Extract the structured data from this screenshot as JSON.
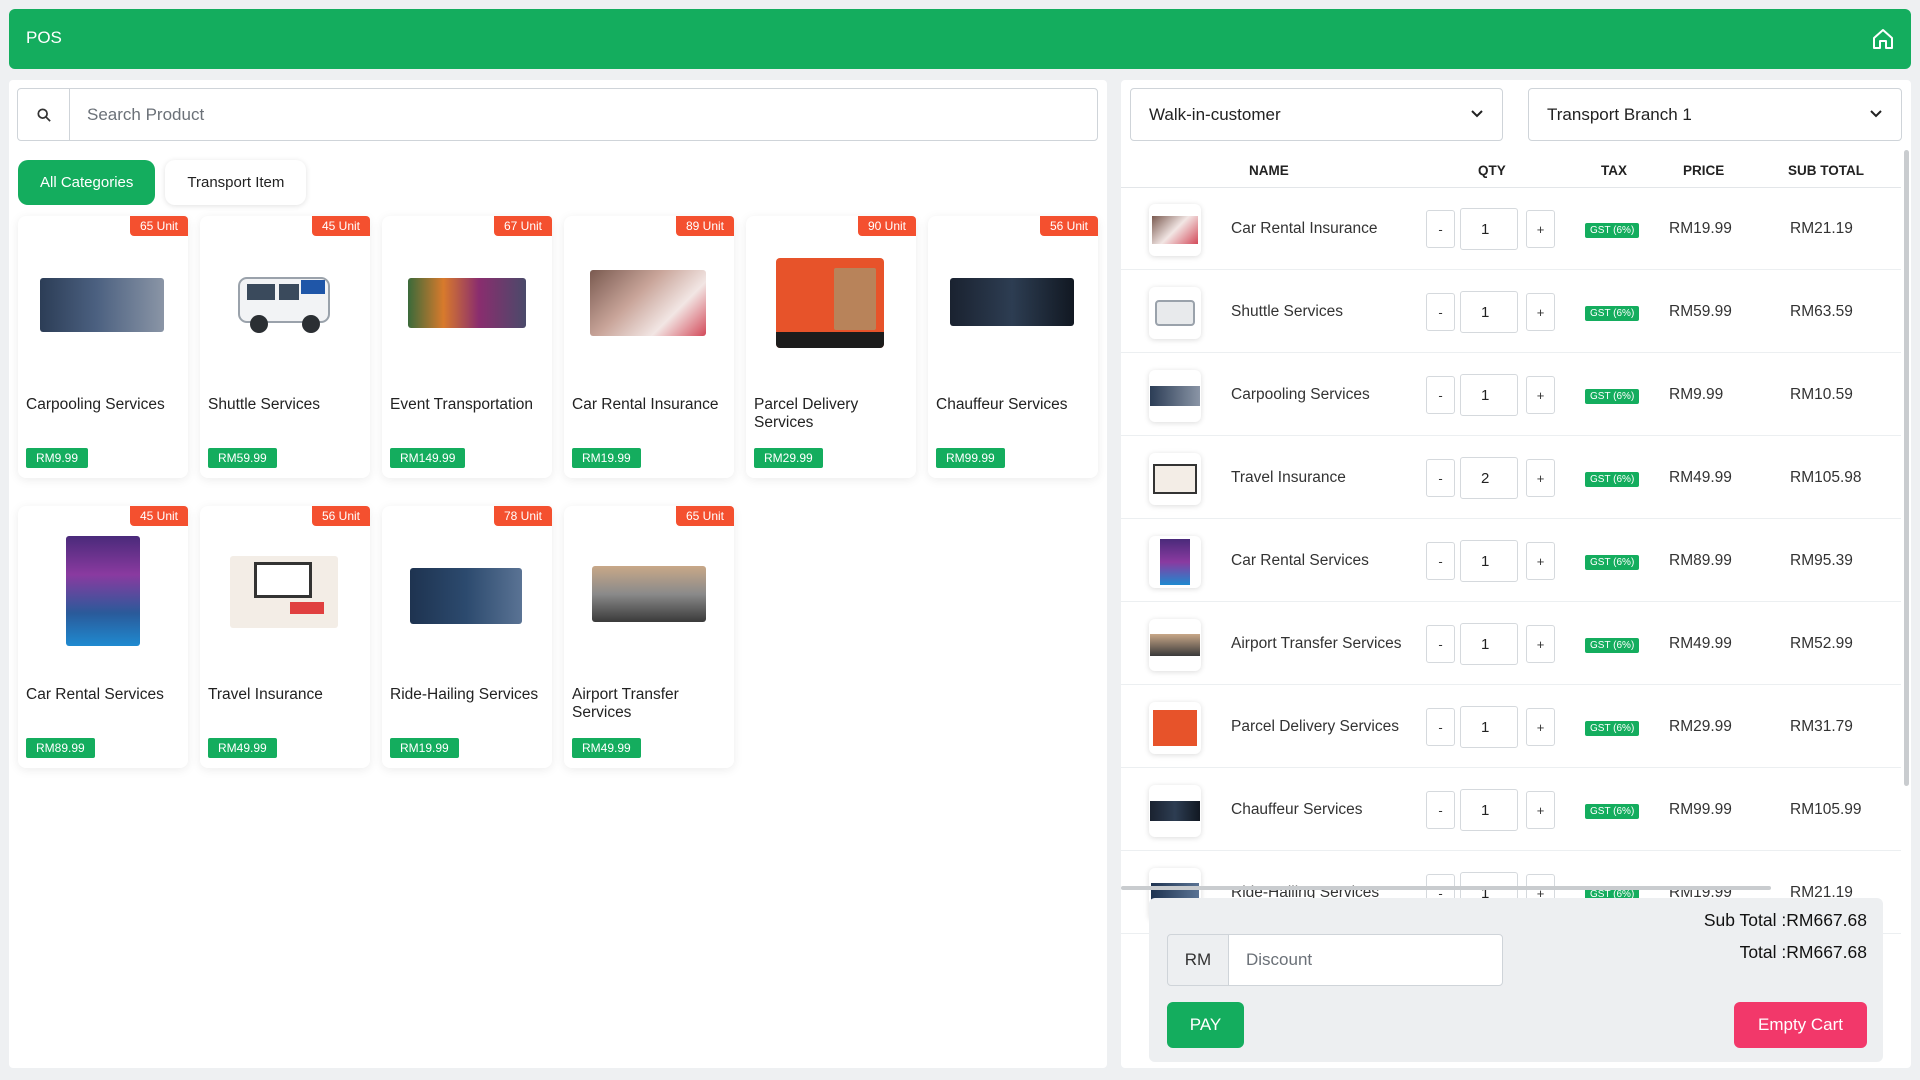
{
  "header": {
    "title": "POS",
    "home_icon": "home-icon"
  },
  "search": {
    "placeholder": "Search Product",
    "value": ""
  },
  "categories": [
    "All Categories",
    "Transport Item"
  ],
  "products": [
    {
      "name": "Carpooling Services",
      "price": "RM9.99",
      "stock": "65 Unit"
    },
    {
      "name": "Shuttle Services",
      "price": "RM59.99",
      "stock": "45 Unit"
    },
    {
      "name": "Event Transportation",
      "price": "RM149.99",
      "stock": "67 Unit"
    },
    {
      "name": "Car Rental Insurance",
      "price": "RM19.99",
      "stock": "89 Unit"
    },
    {
      "name": "Parcel Delivery Services",
      "price": "RM29.99",
      "stock": "90 Unit"
    },
    {
      "name": "Chauffeur Services",
      "price": "RM99.99",
      "stock": "56 Unit"
    },
    {
      "name": "Car Rental Services",
      "price": "RM89.99",
      "stock": "45 Unit"
    },
    {
      "name": "Travel Insurance",
      "price": "RM49.99",
      "stock": "56 Unit"
    },
    {
      "name": "Ride-Hailing Services",
      "price": "RM19.99",
      "stock": "78 Unit"
    },
    {
      "name": "Airport Transfer Services",
      "price": "RM49.99",
      "stock": "65 Unit"
    }
  ],
  "customer_select": {
    "value": "Walk-in-customer"
  },
  "branch_select": {
    "value": "Transport Branch 1"
  },
  "cart": {
    "headers": {
      "name": "NAME",
      "qty": "QTY",
      "tax": "TAX",
      "price": "PRICE",
      "subtotal": "SUB TOTAL"
    },
    "minus": "-",
    "plus": "+",
    "items": [
      {
        "name": "Car Rental Insurance",
        "qty": "1",
        "tax": "GST (6%)",
        "price": "RM19.99",
        "subtotal": "RM21.19"
      },
      {
        "name": "Shuttle Services",
        "qty": "1",
        "tax": "GST (6%)",
        "price": "RM59.99",
        "subtotal": "RM63.59"
      },
      {
        "name": "Carpooling Services",
        "qty": "1",
        "tax": "GST (6%)",
        "price": "RM9.99",
        "subtotal": "RM10.59"
      },
      {
        "name": "Travel Insurance",
        "qty": "2",
        "tax": "GST (6%)",
        "price": "RM49.99",
        "subtotal": "RM105.98"
      },
      {
        "name": "Car Rental Services",
        "qty": "1",
        "tax": "GST (6%)",
        "price": "RM89.99",
        "subtotal": "RM95.39"
      },
      {
        "name": "Airport Transfer Services",
        "qty": "1",
        "tax": "GST (6%)",
        "price": "RM49.99",
        "subtotal": "RM52.99"
      },
      {
        "name": "Parcel Delivery Services",
        "qty": "1",
        "tax": "GST (6%)",
        "price": "RM29.99",
        "subtotal": "RM31.79"
      },
      {
        "name": "Chauffeur Services",
        "qty": "1",
        "tax": "GST (6%)",
        "price": "RM99.99",
        "subtotal": "RM105.99"
      },
      {
        "name": "Ride-Hailing Services",
        "qty": "1",
        "tax": "GST (6%)",
        "price": "RM19.99",
        "subtotal": "RM21.19"
      }
    ]
  },
  "summary": {
    "subtotal": "Sub Total :RM667.68",
    "total": "Total :RM667.68",
    "currency": "RM",
    "discount_placeholder": "Discount",
    "pay": "PAY",
    "empty_cart": "Empty Cart"
  },
  "colors": {
    "primary": "#14ad5e",
    "badge": "#f4502f",
    "danger": "#f2386a"
  }
}
